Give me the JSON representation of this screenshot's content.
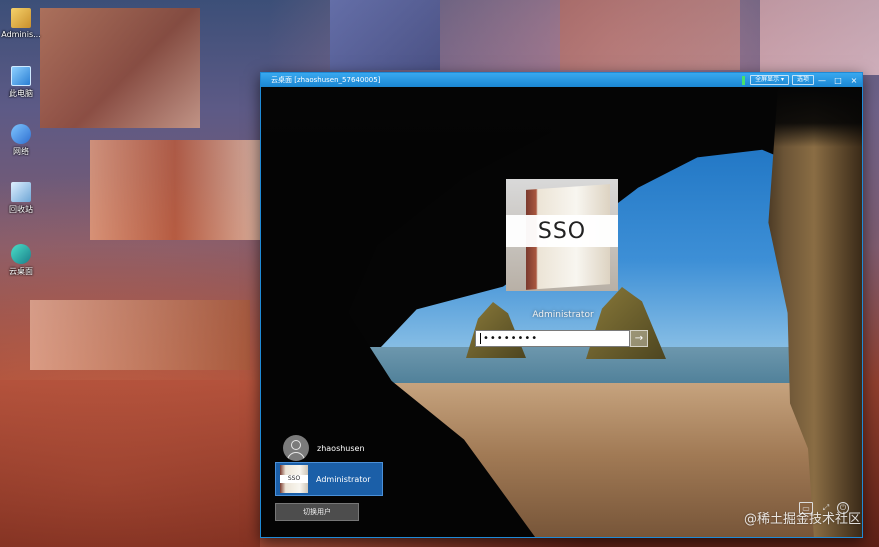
{
  "desktop": {
    "icons": [
      {
        "label": "Adminis...",
        "icon": "user-folder-icon"
      },
      {
        "label": "此电脑",
        "icon": "computer-icon"
      },
      {
        "label": "网络",
        "icon": "network-icon"
      },
      {
        "label": "回收站",
        "icon": "recycle-bin-icon"
      },
      {
        "label": "云桌面",
        "icon": "cloud-desktop-icon"
      }
    ]
  },
  "rdp_window": {
    "title": "云桌面 [zhaoshusen_57640005]",
    "buttons": {
      "display_mode": "全屏显示 ▾",
      "options": "选项"
    },
    "controls": {
      "minimize": "—",
      "maximize": "□",
      "close": "×"
    }
  },
  "lock_screen": {
    "avatar_text": "SSO",
    "username": "Administrator",
    "password_masked": "••••••••",
    "submit_glyph": "→",
    "users": [
      {
        "name": "zhaoshusen",
        "selected": false
      },
      {
        "name": "Administrator",
        "selected": true,
        "thumb_text": "SSO"
      }
    ],
    "switch_user_label": "切换用户",
    "corner_icons": {
      "network": "▭",
      "ease_of_access": "⤢",
      "power": "⏻"
    }
  },
  "watermark": "@稀土掘金技术社区"
}
